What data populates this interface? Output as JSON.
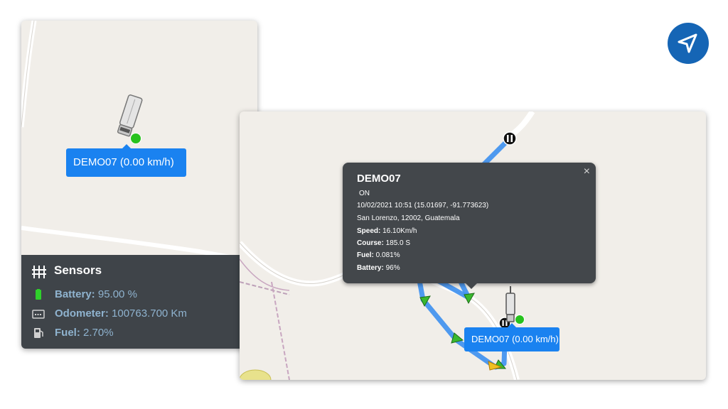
{
  "left_panel": {
    "vehicle_label": "DEMO07 (0.00 km/h)",
    "sensors": {
      "title": "Sensors",
      "items": [
        {
          "label": "Battery:",
          "value": "95.00 %",
          "icon": "battery-icon"
        },
        {
          "label": "Odometer:",
          "value": "100763.700 Km",
          "icon": "odometer-icon"
        },
        {
          "label": "Fuel:",
          "value": "2.70%",
          "icon": "fuel-icon"
        }
      ]
    }
  },
  "right_panel": {
    "vehicle_label": "DEMO07 (0.00 km/h)",
    "popup": {
      "title": "DEMO07",
      "close_glyph": "×",
      "status": "ON",
      "timestamp": "10/02/2021 10:51 (15.01697, -91.773623)",
      "address": "San Lorenzo, 12002, Guatemala",
      "speed_label": "Speed:",
      "speed_value": "16.10Km/h",
      "course_label": "Course:",
      "course_value": "185.0 S",
      "fuel_label": "Fuel:",
      "fuel_value": "0.081%",
      "battery_label": "Battery:",
      "battery_value": "96%"
    }
  },
  "colors": {
    "label_blue": "#1a82f0",
    "route_blue": "#3c8ff0",
    "panel_dark": "#3f4449",
    "status_green": "#27c21d",
    "nav_button": "#1565b5"
  },
  "icons": {
    "nav": "navigation-arrow-icon",
    "sensors": "sensors-icon",
    "vehicle": "truck-icon",
    "pause": "pause-marker-icon"
  }
}
